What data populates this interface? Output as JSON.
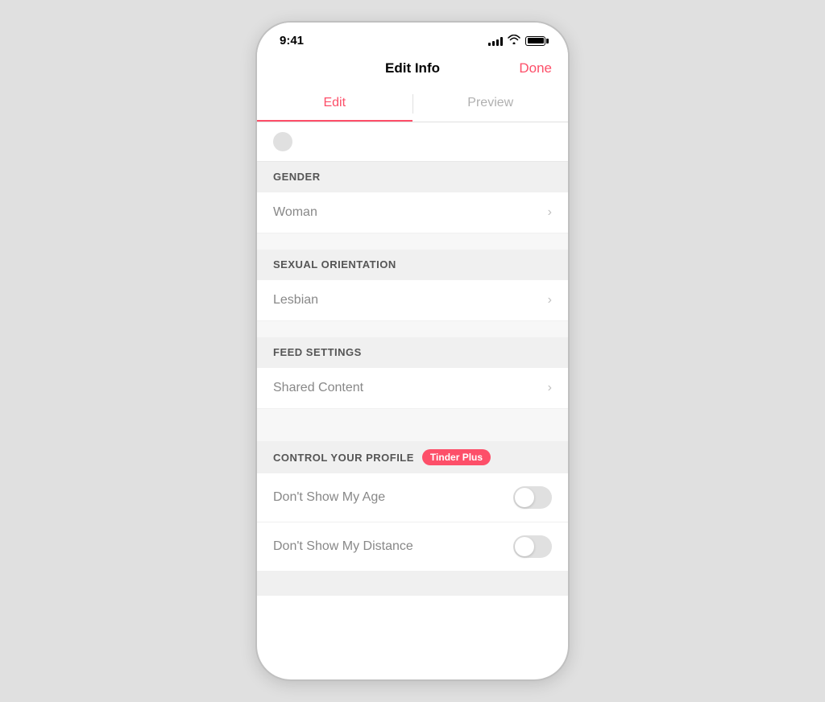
{
  "statusBar": {
    "time": "9:41"
  },
  "navBar": {
    "title": "Edit Info",
    "doneLabel": "Done"
  },
  "tabs": [
    {
      "label": "Edit",
      "active": true
    },
    {
      "label": "Preview",
      "active": false
    }
  ],
  "sections": [
    {
      "id": "gender",
      "header": "GENDER",
      "rows": [
        {
          "value": "Woman"
        }
      ]
    },
    {
      "id": "sexual-orientation",
      "header": "SEXUAL ORIENTATION",
      "rows": [
        {
          "value": "Lesbian"
        }
      ]
    },
    {
      "id": "feed-settings",
      "header": "FEED SETTINGS",
      "rows": [
        {
          "value": "Shared Content"
        }
      ]
    }
  ],
  "controlSection": {
    "header": "CONTROL YOUR PROFILE",
    "badge": "Tinder Plus",
    "toggles": [
      {
        "label": "Don't Show My Age"
      },
      {
        "label": "Don't Show My Distance"
      }
    ]
  }
}
